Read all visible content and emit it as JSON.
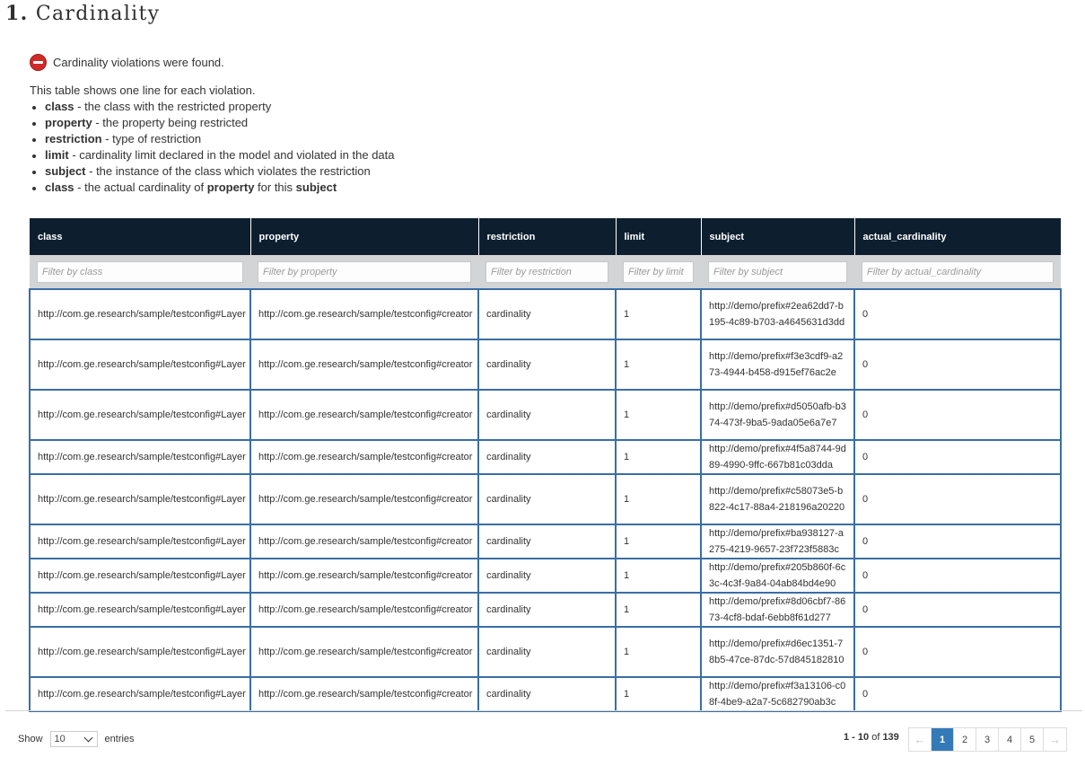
{
  "page": {
    "title_number": "1.",
    "title_text": "Cardinality"
  },
  "alert": {
    "icon": "no-entry-icon",
    "icon_color": "#cf2a27",
    "message": "Cardinality violations were found."
  },
  "intro": {
    "lead": "This table shows one line for each violation.",
    "bullets": [
      {
        "term": "class",
        "desc": " - the class with the restricted property"
      },
      {
        "term": "property",
        "desc": " - the property being restricted"
      },
      {
        "term": "restriction",
        "desc": " - type of restriction"
      },
      {
        "term": "limit",
        "desc": " - cardinality limit declared in the model and violated in the data"
      },
      {
        "term": "subject",
        "desc": " - the instance of the class which violates the restriction"
      }
    ],
    "last_bullet": {
      "term": "class",
      "desc_a": " - the actual cardinality of ",
      "term2": "property",
      "desc_b": " for this ",
      "term3": "subject"
    }
  },
  "table": {
    "header_bg": "#0d1f2f",
    "border_color": "#3a6ea5",
    "columns": [
      {
        "label": "class",
        "placeholder": "Filter by class"
      },
      {
        "label": "property",
        "placeholder": "Filter by property"
      },
      {
        "label": "restriction",
        "placeholder": "Filter by restriction"
      },
      {
        "label": "limit",
        "placeholder": "Filter by limit"
      },
      {
        "label": "subject",
        "placeholder": "Filter by subject"
      },
      {
        "label": "actual_cardinality",
        "placeholder": "Filter by actual_cardinality"
      }
    ],
    "rows": [
      {
        "class": "http://com.ge.research/sample/testconfig#Layer",
        "property": "http://com.ge.research/sample/testconfig#creator",
        "restriction": "cardinality",
        "limit": "1",
        "subject": "http://demo/prefix#2ea62dd7-b195-4c89-b703-a4645631d3dd",
        "actual": "0"
      },
      {
        "class": "http://com.ge.research/sample/testconfig#Layer",
        "property": "http://com.ge.research/sample/testconfig#creator",
        "restriction": "cardinality",
        "limit": "1",
        "subject": "http://demo/prefix#f3e3cdf9-a273-4944-b458-d915ef76ac2e",
        "actual": "0"
      },
      {
        "class": "http://com.ge.research/sample/testconfig#Layer",
        "property": "http://com.ge.research/sample/testconfig#creator",
        "restriction": "cardinality",
        "limit": "1",
        "subject": "http://demo/prefix#d5050afb-b374-473f-9ba5-9ada05e6a7e7",
        "actual": "0"
      },
      {
        "class": "http://com.ge.research/sample/testconfig#Layer",
        "property": "http://com.ge.research/sample/testconfig#creator",
        "restriction": "cardinality",
        "limit": "1",
        "subject": "http://demo/prefix#4f5a8744-9d89-4990-9ffc-667b81c03dda",
        "actual": "0"
      },
      {
        "class": "http://com.ge.research/sample/testconfig#Layer",
        "property": "http://com.ge.research/sample/testconfig#creator",
        "restriction": "cardinality",
        "limit": "1",
        "subject": "http://demo/prefix#c58073e5-b822-4c17-88a4-218196a20220",
        "actual": "0"
      },
      {
        "class": "http://com.ge.research/sample/testconfig#Layer",
        "property": "http://com.ge.research/sample/testconfig#creator",
        "restriction": "cardinality",
        "limit": "1",
        "subject": "http://demo/prefix#ba938127-a275-4219-9657-23f723f5883c",
        "actual": "0"
      },
      {
        "class": "http://com.ge.research/sample/testconfig#Layer",
        "property": "http://com.ge.research/sample/testconfig#creator",
        "restriction": "cardinality",
        "limit": "1",
        "subject": "http://demo/prefix#205b860f-6c3c-4c3f-9a84-04ab84bd4e90",
        "actual": "0"
      },
      {
        "class": "http://com.ge.research/sample/testconfig#Layer",
        "property": "http://com.ge.research/sample/testconfig#creator",
        "restriction": "cardinality",
        "limit": "1",
        "subject": "http://demo/prefix#8d06cbf7-8673-4cf8-bdaf-6ebb8f61d277",
        "actual": "0"
      },
      {
        "class": "http://com.ge.research/sample/testconfig#Layer",
        "property": "http://com.ge.research/sample/testconfig#creator",
        "restriction": "cardinality",
        "limit": "1",
        "subject": "http://demo/prefix#d6ec1351-78b5-47ce-87dc-57d845182810",
        "actual": "0"
      },
      {
        "class": "http://com.ge.research/sample/testconfig#Layer",
        "property": "http://com.ge.research/sample/testconfig#creator",
        "restriction": "cardinality",
        "limit": "1",
        "subject": "http://demo/prefix#f3a13106-c08f-4be9-a2a7-5c682790ab3c",
        "actual": "0"
      }
    ]
  },
  "length": {
    "show_label": "Show",
    "selected": "10",
    "entries_label": "entries"
  },
  "info": {
    "range": "1 - 10",
    "of_label": " of ",
    "total": "139"
  },
  "pagination": {
    "prev": "←",
    "next": "→",
    "pages": [
      "1",
      "2",
      "3",
      "4",
      "5"
    ],
    "active_page": "1",
    "active_color": "#337ab7"
  }
}
